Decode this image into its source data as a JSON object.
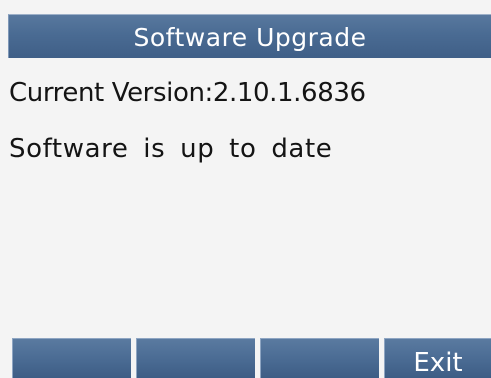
{
  "header": {
    "title": "Software Upgrade"
  },
  "content": {
    "current_version": "Current  Version:2.10.1.6836",
    "status": "Software is up to date"
  },
  "softkeys": [
    {
      "label": ""
    },
    {
      "label": ""
    },
    {
      "label": ""
    },
    {
      "label": "Exit"
    }
  ],
  "colors": {
    "title_bar": "#4a6b93",
    "softkey": "#4b6c94",
    "background": "#f4f4f4",
    "text": "#141414"
  }
}
